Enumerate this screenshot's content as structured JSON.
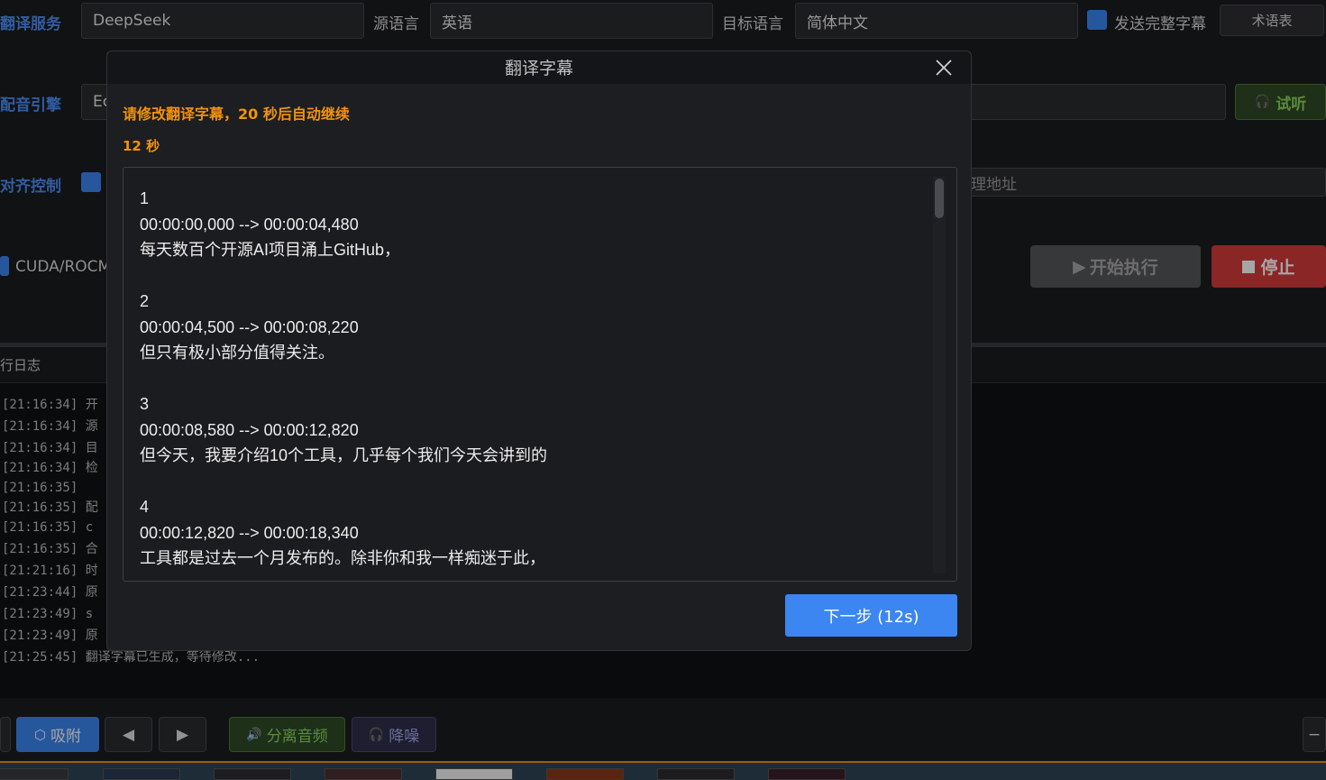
{
  "top_row": {
    "translate_service_label": "翻译服务",
    "translate_service_value": "DeepSeek",
    "source_lang_label": "源语言",
    "source_lang_value": "英语",
    "target_lang_label": "目标语言",
    "target_lang_value": "简体中文",
    "send_full_subtitle_label": "发送完整字幕",
    "glossary_button": "术语表"
  },
  "dub_row": {
    "label": "配音引擎",
    "value_partial": "Ec",
    "listen_button": "试听"
  },
  "align_row": {
    "label": "对齐控制",
    "proxy_placeholder_partial": "理地址"
  },
  "cuda_row": {
    "cuda_label_partial": "CUDA/ROCM",
    "start_button": "开始执行",
    "stop_button": "停止"
  },
  "log": {
    "header_partial": "行日志",
    "lines": [
      "[21:16:34] 开",
      "[21:16:34] 源",
      "[21:16:34] 目",
      "[21:16:34] 检",
      "[21:16:35]",
      "[21:16:35] 配",
      "[21:16:35] c",
      "[21:16:35] 合",
      "[21:21:16] 时",
      "[21:23:44] 原",
      "[21:23:49] s",
      "[21:23:49] 原",
      "[21:25:45] 翻译字幕已生成，等待修改..."
    ]
  },
  "bottom_toolbar": {
    "snap_button": "吸附",
    "prev_icon": "left-arrow-icon",
    "next_icon": "right-arrow-icon",
    "separate_audio_button": "分离音频",
    "denoise_button": "降噪"
  },
  "dialog": {
    "title": "翻译字幕",
    "notice": "请修改翻译字幕，20 秒后自动继续",
    "countdown": "12 秒",
    "subtitle_text": "1\n00:00:00,000 --> 00:00:04,480\n每天数百个开源AI项目涌上GitHub，\n\n2\n00:00:04,500 --> 00:00:08,220\n但只有极小部分值得关注。\n\n3\n00:00:08,580 --> 00:00:12,820\n但今天，我要介绍10个工具，几乎每个我们今天会讲到的\n\n4\n00:00:12,820 --> 00:00:18,340\n工具都是过去一个月发布的。除非你和我一样痴迷于此，",
    "next_button": "下一步 (12s)"
  },
  "colors": {
    "accent": "#3b86f0",
    "label_blue": "#4c8ef7",
    "orange": "#f2930a",
    "stop_red": "#d63b3b",
    "listen_green": "#2e4a25"
  }
}
